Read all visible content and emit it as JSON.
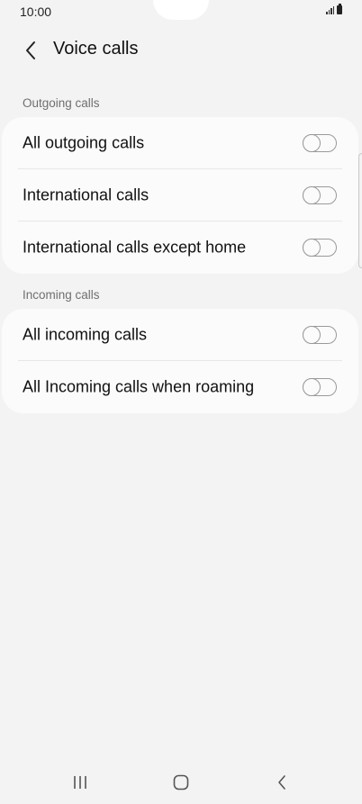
{
  "status_bar": {
    "time": "10:00"
  },
  "header": {
    "title": "Voice calls"
  },
  "outgoing": {
    "title": "Outgoing calls",
    "items": [
      {
        "label": "All outgoing calls",
        "enabled": false
      },
      {
        "label": "International calls",
        "enabled": false
      },
      {
        "label": "International calls except home",
        "enabled": false
      }
    ]
  },
  "incoming": {
    "title": "Incoming calls",
    "items": [
      {
        "label": "All incoming calls",
        "enabled": false
      },
      {
        "label": "All Incoming calls when roaming",
        "enabled": false
      }
    ]
  },
  "colors": {
    "background": "#f3f3f3",
    "card": "#fbfbfb",
    "section_title": "#6f6f6f",
    "toggle_off": "#9a9a9a"
  },
  "icons": [
    "signal-icon",
    "battery-icon",
    "back-arrow-icon",
    "recent-apps-icon",
    "home-icon",
    "back-icon"
  ]
}
